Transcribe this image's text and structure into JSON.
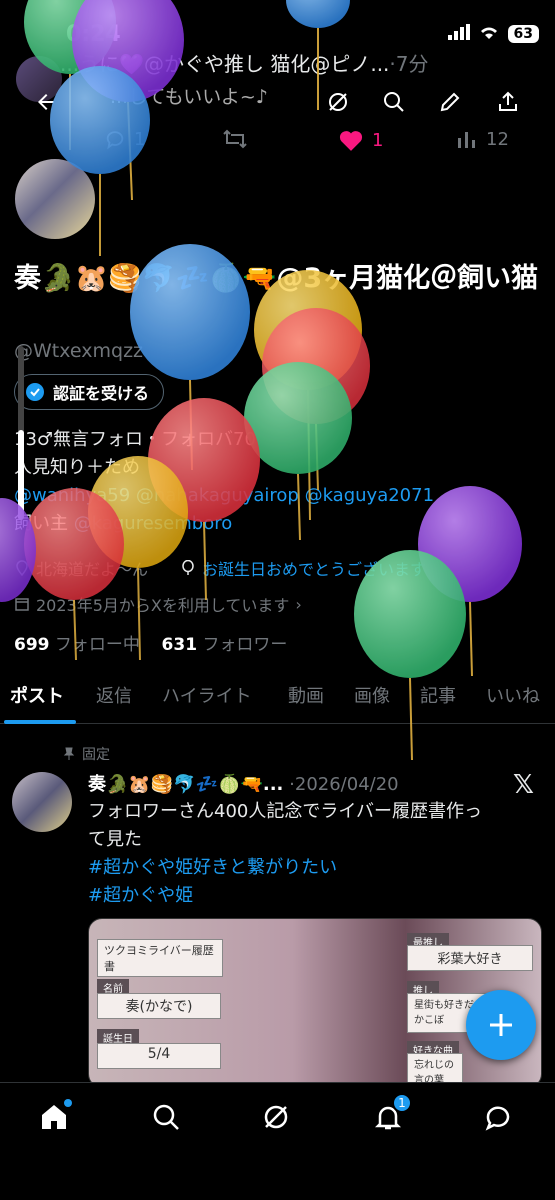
{
  "status_bar": {
    "time": "0:24",
    "battery": "63"
  },
  "header": {
    "title": "...うに💜@かぐや推し 猫化@ピノ...",
    "title_suffix": "·7分",
    "subtitle": "...してもいいよ~♪",
    "reply_count": "1",
    "like_count": "1",
    "view_count": "12"
  },
  "profile": {
    "display_name": "奏🐊🐹🥞🐬💤🍈🔫@3ヶ月猫化＠飼い猫",
    "handle": "@Wtxexmqzz",
    "verify_label": "認証を受ける",
    "bio_line1": "13♂無言フォロ・フォロバ70",
    "bio_line2": "人見知り＋ため",
    "bio_links": "@wanihya59 @nahakaguyairop @kaguya2071",
    "bio_line4_prefix": "飼い主",
    "bio_line4_link": "@kaguresemboro",
    "location": "北海道だよ〜ん",
    "birthday": "お誕生日おめでとうございます",
    "joined": "2023年5月からXを利用しています",
    "following_count": "699",
    "following_label": "フォロー中",
    "followers_count": "631",
    "followers_label": "フォロワー"
  },
  "tabs": [
    "ポスト",
    "返信",
    "ハイライト",
    "動画",
    "画像",
    "記事",
    "いいね"
  ],
  "post": {
    "pinned_label": "固定",
    "author": "奏🐊🐹🥞🐬💤🍈🔫...",
    "date": "2026/04/20",
    "text_line1": "フォロワーさん400人記念でライバー履歴書作っ",
    "text_line2": "て見た",
    "hashtag1": "#超かぐや姫好きと繋がりたい",
    "hashtag2": "#超かぐや姫",
    "image": {
      "card_title": "ツクヨミライバー履歴書",
      "name_label": "名前",
      "name_value": "奏(かなで)",
      "birthday_label": "誕生日",
      "birthday_value": "5/4",
      "oshi_label": "最推し",
      "oshi_value": "彩葉大好き",
      "oshi2_label": "推し",
      "oshi2_value": "星街も好きだかこぼ",
      "song_label": "好きな曲",
      "song_value": "忘れじの言の葉"
    }
  },
  "colors": {
    "accent": "#1d9bf0",
    "like": "#f91880"
  }
}
